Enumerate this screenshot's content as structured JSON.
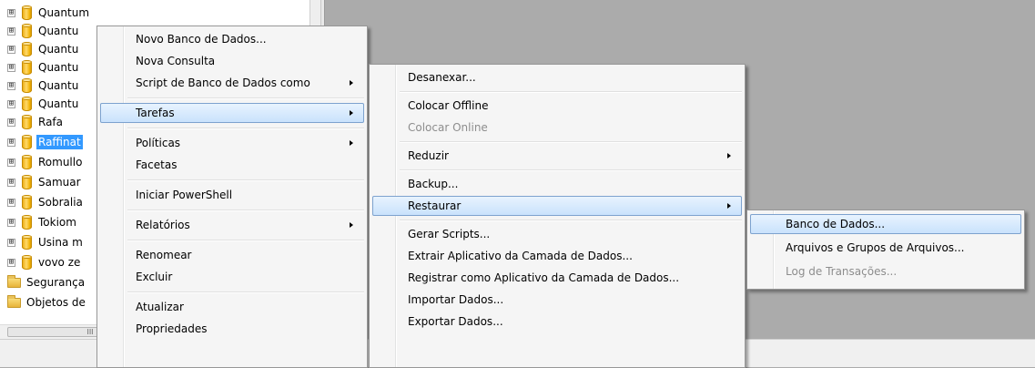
{
  "explorer": {
    "tree_items": [
      {
        "label": "Quantum",
        "icon": "database-icon",
        "expander": "⊞"
      },
      {
        "label": "Quantu",
        "icon": "database-icon",
        "expander": "⊞"
      },
      {
        "label": "Quantu",
        "icon": "database-icon",
        "expander": "⊞"
      },
      {
        "label": "Quantu",
        "icon": "database-icon",
        "expander": "⊞"
      },
      {
        "label": "Quantu",
        "icon": "database-icon",
        "expander": "⊞"
      },
      {
        "label": "Quantu",
        "icon": "database-icon",
        "expander": "⊞"
      },
      {
        "label": "Rafa",
        "icon": "database-icon",
        "expander": "⊞"
      },
      {
        "label": "Raffinat",
        "icon": "database-icon",
        "expander": "⊞",
        "selected": true
      },
      {
        "label": "Romullo",
        "icon": "database-icon",
        "expander": "⊞"
      },
      {
        "label": "Samuar",
        "icon": "database-icon",
        "expander": "⊞"
      },
      {
        "label": "Sobralia",
        "icon": "database-icon",
        "expander": "⊞"
      },
      {
        "label": "Tokiom",
        "icon": "database-icon",
        "expander": "⊞"
      },
      {
        "label": "Usina m",
        "icon": "database-icon",
        "expander": "⊞"
      },
      {
        "label": "vovo ze",
        "icon": "database-icon",
        "expander": "⊞"
      },
      {
        "label": "Segurança",
        "icon": "folder-icon",
        "expander": ""
      },
      {
        "label": "Objetos de",
        "icon": "folder-icon",
        "expander": ""
      }
    ],
    "scroll_grip": "III"
  },
  "menus": {
    "main": {
      "items": [
        {
          "label": "Novo Banco de Dados..."
        },
        {
          "label": "Nova Consulta"
        },
        {
          "label": "Script de Banco de Dados como",
          "submenu": true
        },
        {
          "separator": true
        },
        {
          "label": "Tarefas",
          "submenu": true,
          "highlighted": true
        },
        {
          "separator": true
        },
        {
          "label": "Políticas",
          "submenu": true
        },
        {
          "label": "Facetas"
        },
        {
          "separator": true
        },
        {
          "label": "Iniciar PowerShell"
        },
        {
          "separator": true
        },
        {
          "label": "Relatórios",
          "submenu": true
        },
        {
          "separator": true
        },
        {
          "label": "Renomear"
        },
        {
          "label": "Excluir"
        },
        {
          "separator": true
        },
        {
          "label": "Atualizar"
        },
        {
          "label": "Propriedades"
        }
      ]
    },
    "tarefas": {
      "items": [
        {
          "label": "Desanexar..."
        },
        {
          "separator": true
        },
        {
          "label": "Colocar Offline"
        },
        {
          "label": "Colocar Online",
          "disabled": true
        },
        {
          "separator": true
        },
        {
          "label": "Reduzir",
          "submenu": true
        },
        {
          "separator": true
        },
        {
          "label": "Backup..."
        },
        {
          "label": "Restaurar",
          "submenu": true,
          "highlighted": true
        },
        {
          "separator": true
        },
        {
          "label": "Gerar Scripts..."
        },
        {
          "label": "Extrair Aplicativo da Camada de Dados..."
        },
        {
          "label": "Registrar como Aplicativo da Camada de Dados..."
        },
        {
          "label": "Importar Dados..."
        },
        {
          "label": "Exportar Dados..."
        }
      ]
    },
    "restaurar": {
      "items": [
        {
          "label": "Banco de Dados...",
          "highlighted": true
        },
        {
          "label": "Arquivos e Grupos de Arquivos..."
        },
        {
          "label": "Log de Transações...",
          "disabled": true
        }
      ]
    }
  },
  "colors": {
    "selection": "#3399ff",
    "menu_highlight_border": "#7da2ce",
    "workspace": "#ababab"
  }
}
